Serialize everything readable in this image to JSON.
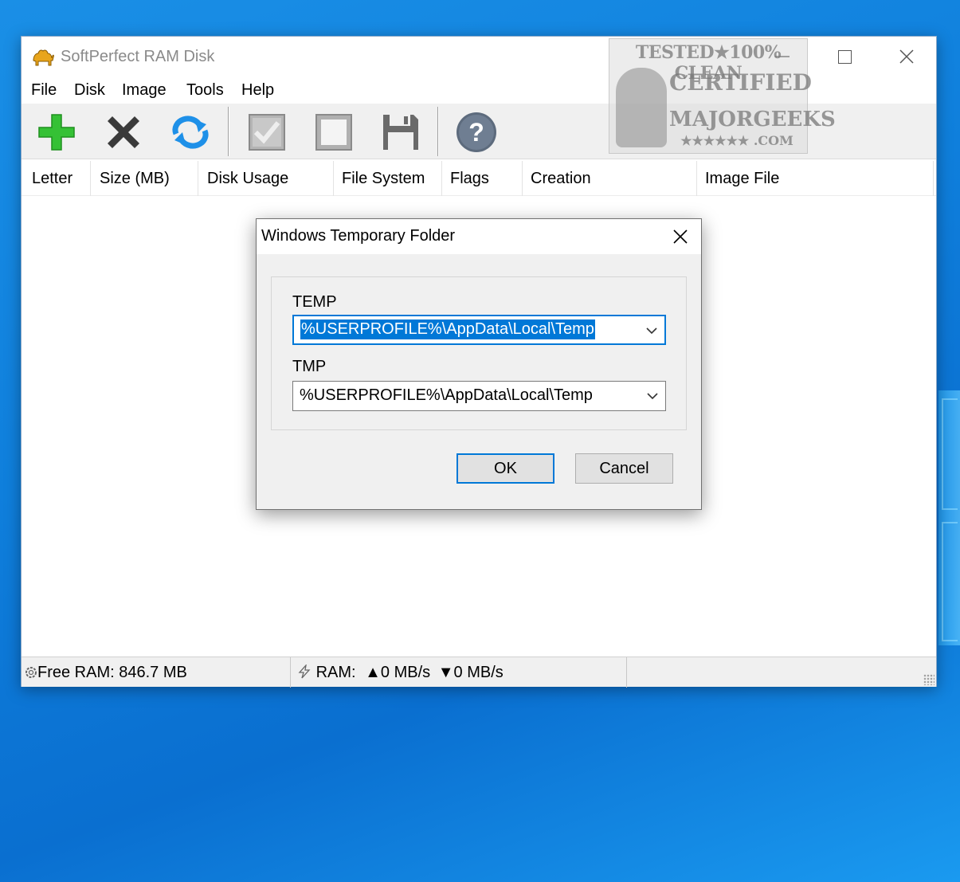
{
  "app": {
    "title": "SoftPerfect RAM Disk"
  },
  "menu": [
    "File",
    "Disk",
    "Image",
    "Tools",
    "Help"
  ],
  "toolbar": {
    "buttons": [
      {
        "name": "add-disk",
        "icon": "plus-icon",
        "color": "#2eb82e"
      },
      {
        "name": "remove-disk",
        "icon": "x-icon",
        "color": "#3a3a3a"
      },
      {
        "name": "refresh",
        "icon": "refresh-icon",
        "color": "#1e90e8"
      },
      {
        "name": "checkmark",
        "icon": "check-icon",
        "color": "#9a9a9a"
      },
      {
        "name": "square",
        "icon": "square-icon",
        "color": "#9a9a9a"
      },
      {
        "name": "save",
        "icon": "floppy-icon",
        "color": "#6a6a6a"
      },
      {
        "name": "help",
        "icon": "question-icon",
        "color": "#5d6b7d"
      }
    ]
  },
  "watermark": {
    "line1": "TESTED★100% CLEAN",
    "line2": "CERTIFIED",
    "line3": "MAJORGEEKS",
    "line4": "★★★★★★ .COM"
  },
  "columns": [
    "Letter",
    "Size (MB)",
    "Disk Usage",
    "File System",
    "Flags",
    "Creation",
    "Image File"
  ],
  "status": {
    "free_ram": "Free RAM: 846.7 MB",
    "ram_label": "RAM:",
    "ram_up": "▲0 MB/s",
    "ram_down": "▼0 MB/s"
  },
  "dialog": {
    "title": "Windows Temporary Folder",
    "temp_label": "TEMP",
    "temp_value": "%USERPROFILE%\\AppData\\Local\\Temp",
    "tmp_label": "TMP",
    "tmp_value": "%USERPROFILE%\\AppData\\Local\\Temp",
    "ok_label": "OK",
    "cancel_label": "Cancel"
  },
  "colors": {
    "accent": "#0078d7",
    "desktop": "#0f7fdc"
  }
}
